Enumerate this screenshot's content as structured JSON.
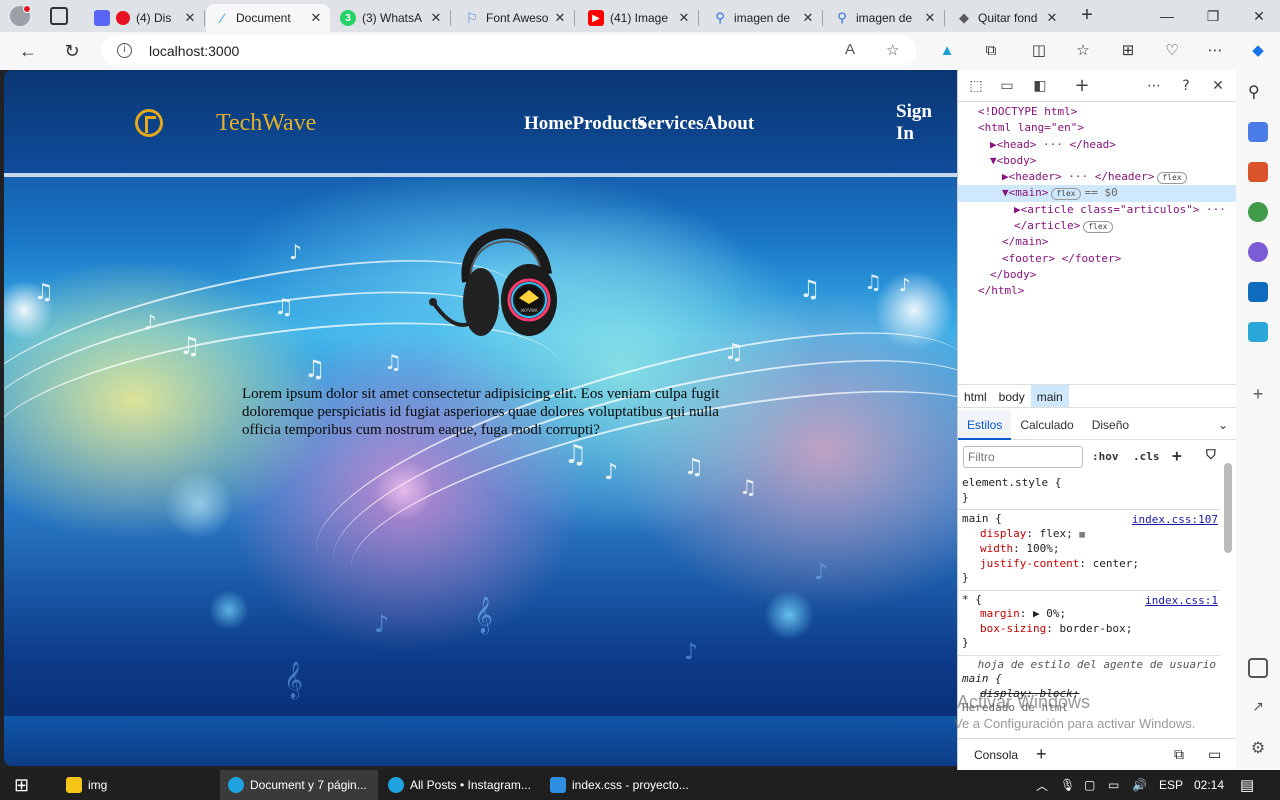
{
  "browser": {
    "tabs": [
      {
        "title": "(4) Dis",
        "favicon": "discord-icon",
        "color": "#5865f2",
        "active": false
      },
      {
        "title": "Document",
        "favicon": "feather-icon",
        "color": "#5fb4e8",
        "active": true
      },
      {
        "title": "(3) WhatsA",
        "favicon": "whatsapp-icon",
        "color": "#25d366",
        "active": false
      },
      {
        "title": "Font Aweso",
        "favicon": "flag-icon",
        "color": "#528dd7",
        "active": false
      },
      {
        "title": "(41) Image",
        "favicon": "youtube-icon",
        "color": "#ff0000",
        "active": false
      },
      {
        "title": "imagen de",
        "favicon": "search-icon",
        "color": "#2b6ce0",
        "active": false
      },
      {
        "title": "imagen de",
        "favicon": "search-icon",
        "color": "#2b6ce0",
        "active": false
      },
      {
        "title": "Quitar fond",
        "favicon": "shape-icon",
        "color": "#5a5a5a",
        "active": false
      }
    ],
    "url": "localhost:3000",
    "tab_badge": "3"
  },
  "site": {
    "brand": "TechWave",
    "nav": [
      "Home",
      "Products",
      "Services",
      "About"
    ],
    "signin": "Sign In",
    "paragraph": "Lorem ipsum dolor sit amet consectetur adipisicing elit. Eos veniam culpa fugit doloremque perspiciatis id fugiat asperiores quae dolores voluptatibus qui nulla officia temporibus cum nostrum eaque, fuga modi corrupti?",
    "headphone_brand": "AKYVWA"
  },
  "devtools": {
    "dom": [
      {
        "text": "<!DOCTYPE html>",
        "indent": 0
      },
      {
        "text": "<html lang=\"en\">",
        "indent": 0
      },
      {
        "text": "▶<head> ··· </head>",
        "indent": 1
      },
      {
        "text": "▼<body>",
        "indent": 1
      },
      {
        "text": "▶<header> ··· </header>",
        "indent": 2,
        "pill": "flex"
      },
      {
        "text": "▼<main>",
        "indent": 2,
        "pill": "flex",
        "suffix": "== $0",
        "selected": true
      },
      {
        "text": "▶<article class=\"articulos\"> ···",
        "indent": 3
      },
      {
        "text": "</article>",
        "indent": 3,
        "pill": "flex"
      },
      {
        "text": "</main>",
        "indent": 2
      },
      {
        "text": "<footer> </footer>",
        "indent": 2
      },
      {
        "text": "</body>",
        "indent": 1
      },
      {
        "text": "</html>",
        "indent": 0
      }
    ],
    "breadcrumbs": [
      "html",
      "body",
      "main"
    ],
    "style_tabs": [
      "Estilos",
      "Calculado",
      "Diseño"
    ],
    "filter_placeholder": "Filtro",
    "hov": ":hov",
    "cls": ".cls",
    "rules": [
      {
        "selector": "element.style {",
        "source": "",
        "props": [],
        "close": "}"
      },
      {
        "selector": "main {",
        "source": "index.css:107",
        "props": [
          [
            "display",
            "flex;"
          ],
          [
            "width",
            "100%;"
          ],
          [
            "justify-content",
            "center;"
          ]
        ],
        "close": "}"
      },
      {
        "selector": "* {",
        "source": "index.css:1",
        "props": [
          [
            "margin",
            "▶ 0%;"
          ],
          [
            "box-sizing",
            "border-box;"
          ]
        ],
        "close": "}"
      },
      {
        "selector": "hoja de estilo del agente de usuario",
        "source": "",
        "props": [],
        "close": ""
      }
    ],
    "ua_rule": {
      "selector": "main {",
      "prop": "display: block;"
    },
    "inherited": "Heredado de html",
    "console_tab": "Consola"
  },
  "watermark": {
    "title": "Activar Windows",
    "subtitle": "Ve a Configuración para activar Windows."
  },
  "taskbar": {
    "items": [
      {
        "label": "img",
        "icon": "folder-icon",
        "color": "#f5c518"
      },
      {
        "label": "Document y 7 págin...",
        "icon": "edge-icon",
        "color": "#1ea2e0",
        "active": true
      },
      {
        "label": "All Posts • Instagram...",
        "icon": "edge-icon",
        "color": "#1ea2e0",
        "active": false
      },
      {
        "label": "index.css - proyecto...",
        "icon": "vscode-icon",
        "color": "#2f8fe0",
        "active": false
      }
    ],
    "lang": "ESP",
    "time": "02:14"
  }
}
